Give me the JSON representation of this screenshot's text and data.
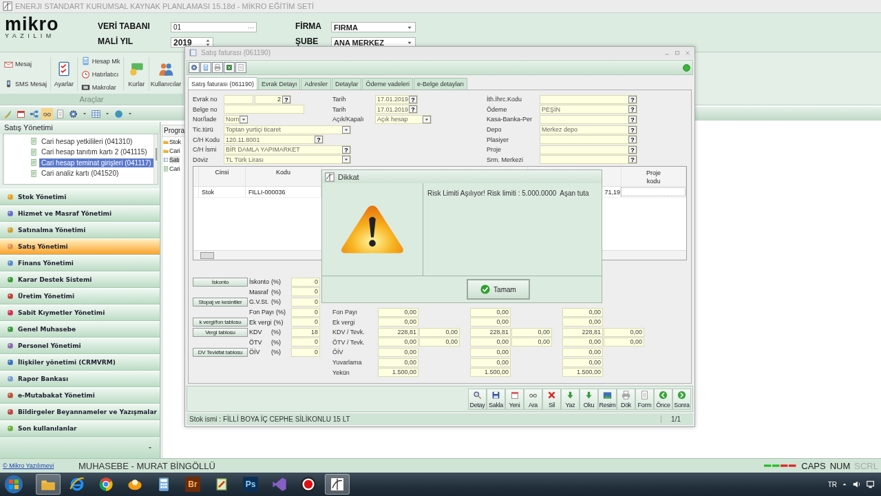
{
  "window": {
    "title": "ENERJI STANDART KURUMSAL KAYNAK PLANLAMASI 15.18d - MİKRO EĞİTİM SETİ"
  },
  "header": {
    "logo": "mikro",
    "tagline": "YAZILIM",
    "fields": [
      {
        "label": "VERİ TABANI",
        "kind": "browse",
        "value": "01",
        "btn": "···"
      },
      {
        "label": "FİRMA",
        "kind": "dropdown",
        "value": "FIRMA"
      },
      {
        "label": "MALİ YIL",
        "kind": "spin",
        "value": "2019"
      },
      {
        "label": "ŞUBE",
        "kind": "dropdown",
        "value": "ANA MERKEZ"
      }
    ]
  },
  "ribbon": {
    "group": "Araçlar",
    "columns": [
      {
        "kind": "small",
        "items": [
          {
            "label": "Mesaj"
          },
          {
            "label": "SMS Mesaj"
          }
        ]
      },
      {
        "kind": "large",
        "items": [
          {
            "label": "Ayarlar"
          }
        ]
      },
      {
        "kind": "small",
        "items": [
          {
            "label": "Hesap Mk"
          },
          {
            "label": "Hatırlatıcı"
          },
          {
            "label": "Makrolar"
          }
        ]
      },
      {
        "kind": "large",
        "items": [
          {
            "label": "Kurlar"
          }
        ]
      },
      {
        "kind": "large",
        "items": [
          {
            "label": "Kullanıcılar"
          }
        ]
      }
    ]
  },
  "navigator": {
    "title": "Satış Yönetimi",
    "tree": [
      {
        "label": "Cari hesap yetkilileri (041310)",
        "selected": false
      },
      {
        "label": "Cari hesap tanıtım kartı 2 (041115)",
        "selected": false
      },
      {
        "label": "Cari hesap teminat girişleri (041117)",
        "selected": true
      },
      {
        "label": "Cari analiz kartı (041520)",
        "selected": false
      }
    ],
    "modules": [
      {
        "label": "Stok Yönetimi",
        "selected": false
      },
      {
        "label": "Hizmet ve Masraf Yönetimi",
        "selected": false
      },
      {
        "label": "Satınalma Yönetimi",
        "selected": false
      },
      {
        "label": "Satış Yönetimi",
        "selected": true
      },
      {
        "label": "Finans Yönetimi",
        "selected": false
      },
      {
        "label": "Karar Destek Sistemi",
        "selected": false
      },
      {
        "label": "Üretim Yönetimi",
        "selected": false
      },
      {
        "label": "Sabit Kıymetler Yönetimi",
        "selected": false
      },
      {
        "label": "Genel Muhasebe",
        "selected": false
      },
      {
        "label": "Personel Yönetimi",
        "selected": false
      },
      {
        "label": "İlişkiler yönetimi (CRMVRM)",
        "selected": false
      },
      {
        "label": "Rapor Bankası",
        "selected": false
      },
      {
        "label": "e-Mutabakat Yönetimi",
        "selected": false
      },
      {
        "label": "Bildirgeler Beyannameler ve Yazışmalar",
        "selected": false
      },
      {
        "label": "Son kullanılanlar",
        "selected": false
      }
    ]
  },
  "programs": {
    "title": "Progra",
    "items": [
      {
        "label": "Stok",
        "selected": false
      },
      {
        "label": "Cari",
        "selected": false
      },
      {
        "label": "Satı",
        "selected": true
      },
      {
        "label": "Cari",
        "selected": false
      }
    ]
  },
  "invoice": {
    "title": "Satış faturası (061190)",
    "tabs": [
      {
        "label": "Satış faturası (061190)",
        "selected": true
      },
      {
        "label": "Evrak Detayı",
        "selected": false
      },
      {
        "label": "Adresler",
        "selected": false
      },
      {
        "label": "Detaylar",
        "selected": false
      },
      {
        "label": "Ödeme vadeleri",
        "selected": false
      },
      {
        "label": "e-Belge detayları",
        "selected": false
      }
    ],
    "form": [
      {
        "fields": [
          {
            "label": "Evrak no",
            "kind": "serial",
            "value": "2",
            "btn": "?"
          },
          {
            "label": "Belge no",
            "kind": "text"
          },
          {
            "label": "Nor/İade",
            "kind": "dropdown",
            "value": "Norn"
          },
          {
            "label": "Tic.türü",
            "kind": "dropdown",
            "value": "Toptan yurtiçi ticaret"
          },
          {
            "label": "C/H Kodu",
            "kind": "lookup",
            "value": "120.11.8001",
            "btn": "?"
          },
          {
            "label": "C/H İsmi",
            "kind": "lookup",
            "value": "BİR DAMLA YAPIMARKET",
            "btn": "?"
          },
          {
            "label": "Döviz",
            "kind": "dropdown",
            "value": "TL  Türk Lirası"
          }
        ]
      },
      {
        "fields": [
          {
            "label": "Tarih",
            "kind": "lookup",
            "value": "17.01.2019",
            "btn": "?"
          },
          {
            "label": "Tarih",
            "kind": "lookup",
            "value": "17.01.2019",
            "btn": "?"
          },
          {
            "label": "Açık/Kapalı",
            "kind": "dropdown",
            "value": "Açık hesap"
          }
        ]
      },
      {
        "fields": [
          {
            "label": "İth.İhrc.Kodu",
            "kind": "lookup",
            "btn": "?"
          },
          {
            "label": "Ödeme",
            "kind": "lookup",
            "value": "PEŞİN",
            "btn": "?"
          },
          {
            "label": "Kasa-Banka-Per",
            "kind": "lookup",
            "btn": "?"
          },
          {
            "label": "Depo",
            "kind": "lookup",
            "value": "Merkez depo",
            "btn": "?"
          },
          {
            "label": "Plasiyer",
            "kind": "lookup",
            "btn": "?"
          },
          {
            "label": "Proje",
            "kind": "lookup",
            "btn": "?"
          },
          {
            "label": "Srm. Merkezi",
            "kind": "lookup",
            "btn": "?"
          }
        ]
      }
    ],
    "table": {
      "columns": [
        {
          "label": "Cinsi"
        },
        {
          "label": "Kodu"
        },
        {
          "label": "Proje kodu"
        }
      ],
      "rows": [
        {
          "cinsi": "Stok",
          "kodu": "FILLI-000036",
          "column_9": "71,19"
        }
      ]
    },
    "rates": [
      {
        "label": "İskonto",
        "unit": "(%)",
        "value": "0",
        "button": "İskonto"
      },
      {
        "label": "Masraf",
        "unit": "(%)",
        "value": "0"
      },
      {
        "label": "G.V.St.",
        "unit": "(%)",
        "value": "0",
        "button": "Stopaj ve kesintiler"
      },
      {
        "label": "Fon Payı",
        "unit": "(%)",
        "value": "0"
      },
      {
        "label": "Ek vergi",
        "unit": "(%)",
        "value": "0",
        "button": "k vergi/fon tablosu"
      },
      {
        "label": "KDV",
        "unit": "(%)",
        "value": "18",
        "button": "Vergi tablosu"
      },
      {
        "label": "ÖTV",
        "unit": "(%)",
        "value": "0"
      },
      {
        "label": "ÖİV",
        "unit": "(%)",
        "value": "0",
        "button": "DV Tevkifat tablosu"
      }
    ],
    "totals": [
      {
        "label": "Fon Payı",
        "values": [
          "0,00",
          "0,00",
          "0,00"
        ]
      },
      {
        "label": "Ek vergi",
        "values": [
          "0,00",
          "0,00",
          "0,00"
        ]
      },
      {
        "label": "KDV / Tevk.",
        "values": [
          "228,81",
          "228,81",
          "228,81"
        ],
        "tevk": [
          "0,00",
          "0,00",
          "0,00"
        ]
      },
      {
        "label": "ÖTV / Tevk.",
        "values": [
          "0,00",
          "0,00",
          "0,00"
        ],
        "tevk": [
          "0,00",
          "0,00",
          "0,00"
        ]
      },
      {
        "label": "ÖİV",
        "values": [
          "0,00",
          "0,00",
          "0,00"
        ]
      },
      {
        "label": "Yuvarlama",
        "values": [
          "0,00",
          "0,00",
          "0,00"
        ]
      },
      {
        "label": "Yekün",
        "values": [
          "1.500,00",
          "1.500,00",
          "1.500,00"
        ]
      }
    ],
    "actions": [
      {
        "label": "Detay"
      },
      {
        "label": "Sakla"
      },
      {
        "label": "Yeni"
      },
      {
        "label": "Ara"
      },
      {
        "label": "Sil"
      },
      {
        "label": "Yaz"
      },
      {
        "label": "Oku"
      },
      {
        "label": "Resim"
      },
      {
        "label": "Dök"
      },
      {
        "label": "Form"
      },
      {
        "label": "Önce"
      },
      {
        "label": "Sonra"
      }
    ],
    "status": "Stok ismi : FİLLİ BOYA İÇ CEPHE SİLİKONLU 15 LT",
    "page": "1/1"
  },
  "dialog": {
    "title": "Dikkat",
    "message": "Risk Limiti Aşılıyor! Risk limiti : 5.000.0000  Aşan tuta",
    "button": "Tamam"
  },
  "status_bar": {
    "link": "© Mikro Yazılımevi",
    "user": "MUHASEBE - MURAT BİNGÖLLÜ",
    "keys": [
      {
        "label": "CAPS",
        "on": true
      },
      {
        "label": "NUM",
        "on": true
      },
      {
        "label": "SCRL",
        "on": false
      }
    ]
  },
  "taskbar": {
    "apps": [
      {
        "kind": "folder",
        "selected": true
      },
      {
        "kind": "ie",
        "selected": false
      },
      {
        "kind": "chrome",
        "selected": false
      },
      {
        "kind": "orange",
        "selected": false
      },
      {
        "kind": "calc",
        "selected": false
      },
      {
        "kind": "badge",
        "label": "Br",
        "color": "#6b2c0a",
        "selected": false
      },
      {
        "kind": "notepad",
        "selected": false
      },
      {
        "kind": "badge",
        "label": "Ps",
        "color": "#0c2f55",
        "selected": false
      },
      {
        "kind": "vs",
        "selected": false
      },
      {
        "kind": "record",
        "selected": false
      },
      {
        "kind": "mikro",
        "selected": true
      }
    ],
    "lang": "TR"
  }
}
